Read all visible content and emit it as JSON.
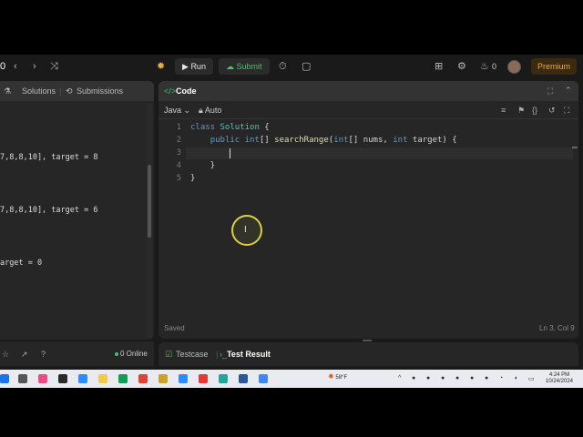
{
  "nav": {
    "run_label": "Run",
    "submit_label": "Submit",
    "notification_count": "0",
    "premium_label": "Premium"
  },
  "left_panel": {
    "tabs": [
      {
        "label": "Solutions"
      },
      {
        "label": "Submissions"
      }
    ],
    "examples": [
      "7,8,8,10], target = 8",
      "7,8,8,10], target = 6",
      "arget = 0"
    ],
    "online_count": "0 Online"
  },
  "code_panel": {
    "title": "Code",
    "tag_glyph": "</>",
    "language": "Java",
    "mode": "Auto",
    "lines": [
      {
        "num": "1",
        "text": "class Solution {"
      },
      {
        "num": "2",
        "text": "    public int[] searchRange(int[] nums, int target) {"
      },
      {
        "num": "3",
        "text": "        "
      },
      {
        "num": "4",
        "text": "    }"
      },
      {
        "num": "5",
        "text": "}"
      }
    ],
    "status_left": "Saved",
    "status_right": "Ln 3, Col 9"
  },
  "bottom_tabs": [
    {
      "label": "Testcase",
      "active": false
    },
    {
      "label": "Test Result",
      "active": true
    }
  ],
  "taskbar": {
    "temperature": "58°F",
    "time": "4:24 PM",
    "date": "10/24/2024"
  },
  "colors": {
    "accent_green": "#3ec46d",
    "premium_orange": "#ffa116",
    "editor_bg": "#262626"
  }
}
